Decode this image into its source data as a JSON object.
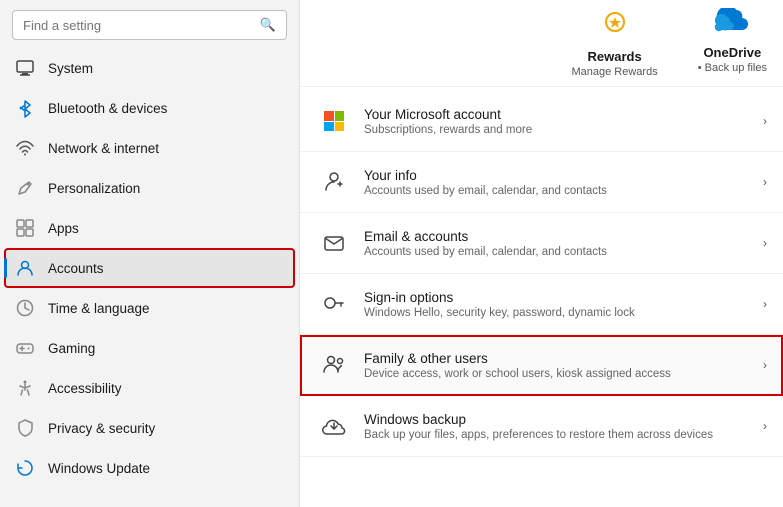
{
  "sidebar": {
    "search_placeholder": "Find a setting",
    "items": [
      {
        "id": "system",
        "label": "System",
        "icon": "system"
      },
      {
        "id": "bluetooth",
        "label": "Bluetooth & devices",
        "icon": "bluetooth"
      },
      {
        "id": "network",
        "label": "Network & internet",
        "icon": "network"
      },
      {
        "id": "personalization",
        "label": "Personalization",
        "icon": "paint"
      },
      {
        "id": "apps",
        "label": "Apps",
        "icon": "apps"
      },
      {
        "id": "accounts",
        "label": "Accounts",
        "icon": "accounts",
        "active": true
      },
      {
        "id": "time",
        "label": "Time & language",
        "icon": "time"
      },
      {
        "id": "gaming",
        "label": "Gaming",
        "icon": "gaming"
      },
      {
        "id": "accessibility",
        "label": "Accessibility",
        "icon": "accessibility"
      },
      {
        "id": "privacy",
        "label": "Privacy & security",
        "icon": "privacy"
      },
      {
        "id": "update",
        "label": "Windows Update",
        "icon": "update"
      }
    ]
  },
  "topbar": {
    "rewards": {
      "title": "Rewards",
      "subtitle": "Manage Rewards"
    },
    "onedrive": {
      "title": "OneDrive",
      "subtitle": "Back up files"
    }
  },
  "content_items": [
    {
      "id": "microsoft-account",
      "title": "Your Microsoft account",
      "subtitle": "Subscriptions, rewards and more",
      "icon": "microsoft"
    },
    {
      "id": "your-info",
      "title": "Your info",
      "subtitle": "Accounts used by email, calendar, and contacts",
      "icon": "person"
    },
    {
      "id": "email-accounts",
      "title": "Email & accounts",
      "subtitle": "Accounts used by email, calendar, and contacts",
      "icon": "email"
    },
    {
      "id": "signin-options",
      "title": "Sign-in options",
      "subtitle": "Windows Hello, security key, password, dynamic lock",
      "icon": "key"
    },
    {
      "id": "family-users",
      "title": "Family & other users",
      "subtitle": "Device access, work or school users, kiosk assigned access",
      "icon": "family",
      "highlighted": true
    },
    {
      "id": "windows-backup",
      "title": "Windows backup",
      "subtitle": "Back up your files, apps, preferences to restore them across devices",
      "icon": "backup"
    }
  ]
}
